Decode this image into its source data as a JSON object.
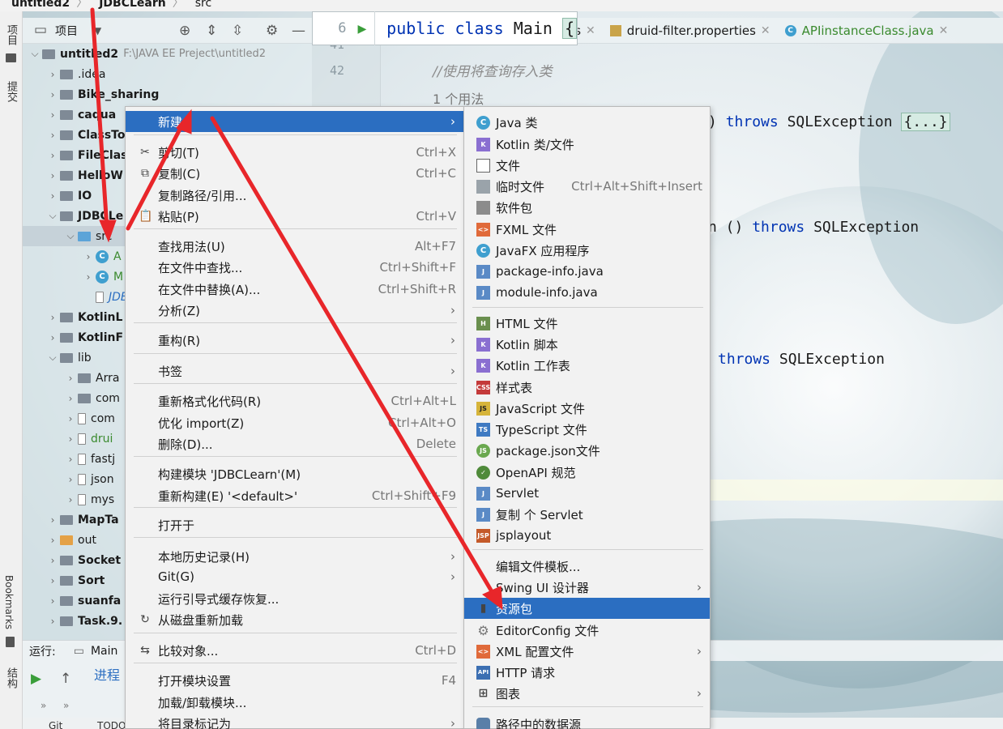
{
  "breadcrumb": {
    "project": "untitled2",
    "module": "JDBCLearn",
    "folder": "src"
  },
  "left_strip": {
    "project_tab": "项目",
    "commit_tab": "提交",
    "bookmarks_tab": "Bookmarks",
    "structure_tab": "结构"
  },
  "project_panel": {
    "title": "项目"
  },
  "tree": [
    {
      "label": "untitled2",
      "path": "F:\\JAVA EE Preject\\untitled2"
    },
    {
      "label": ".idea"
    },
    {
      "label": "Bike_sharing"
    },
    {
      "label": "caqua"
    },
    {
      "label": "ClassTo"
    },
    {
      "label": "FileClas"
    },
    {
      "label": "HelloW"
    },
    {
      "label": "IO"
    },
    {
      "label": "JDBCLe"
    },
    {
      "label": "src"
    },
    {
      "label": "A"
    },
    {
      "label": "M"
    },
    {
      "label": "JDBC"
    },
    {
      "label": "KotlinL"
    },
    {
      "label": "KotlinF"
    },
    {
      "label": "lib"
    },
    {
      "label": "Arra"
    },
    {
      "label": "com"
    },
    {
      "label": "com"
    },
    {
      "label": "drui"
    },
    {
      "label": "fastj"
    },
    {
      "label": "json"
    },
    {
      "label": "mys"
    },
    {
      "label": "MapTa"
    },
    {
      "label": "out"
    },
    {
      "label": "Socket"
    },
    {
      "label": "Sort"
    },
    {
      "label": "suanfa"
    },
    {
      "label": "Task.9."
    }
  ],
  "run_bar": {
    "label": "运行:",
    "tab": "Main",
    "process": "进程"
  },
  "bottom_bar": {
    "git": "Git",
    "todo": "TODO"
  },
  "editor": {
    "sticky": {
      "line": "6",
      "code_kw1": "public",
      "code_kw2": "class",
      "code_name": "Main",
      "brace": "{"
    },
    "line_numbers": [
      "41",
      "42"
    ],
    "comment": "//使用将查询存入类",
    "usage": "1 个用法",
    "code_lines": [
      {
        "pre": ")",
        "kw": "throws",
        "rest": "SQLException",
        "fold": "{...}"
      },
      {
        "pre": "n ()",
        "kw": "throws",
        "rest": "SQLException"
      },
      {
        "pre": "",
        "kw": "throws",
        "rest": "SQLException"
      }
    ]
  },
  "tabs": [
    {
      "label": "es"
    },
    {
      "label": "druid-filter.properties"
    },
    {
      "label": "APIinstanceClass.java"
    }
  ],
  "context_menu": [
    {
      "label": "新建",
      "submenu": true,
      "active": true
    },
    {
      "label": "剪切(T)",
      "shortcut": "Ctrl+X",
      "icon": "scissors-icon"
    },
    {
      "label": "复制(C)",
      "shortcut": "Ctrl+C",
      "icon": "copy-icon"
    },
    {
      "label": "复制路径/引用..."
    },
    {
      "label": "粘贴(P)",
      "shortcut": "Ctrl+V",
      "icon": "paste-icon"
    },
    {
      "label": "查找用法(U)",
      "shortcut": "Alt+F7"
    },
    {
      "label": "在文件中查找...",
      "shortcut": "Ctrl+Shift+F"
    },
    {
      "label": "在文件中替换(A)...",
      "shortcut": "Ctrl+Shift+R"
    },
    {
      "label": "分析(Z)",
      "submenu": true
    },
    {
      "label": "重构(R)",
      "submenu": true
    },
    {
      "label": "书签",
      "submenu": true
    },
    {
      "label": "重新格式化代码(R)",
      "shortcut": "Ctrl+Alt+L"
    },
    {
      "label": "优化 import(Z)",
      "shortcut": "Ctrl+Alt+O"
    },
    {
      "label": "删除(D)...",
      "shortcut": "Delete"
    },
    {
      "label": "构建模块 'JDBCLearn'(M)"
    },
    {
      "label": "重新构建(E) '<default>'",
      "shortcut": "Ctrl+Shift+F9"
    },
    {
      "label": "打开于",
      "submenu": true
    },
    {
      "label": "本地历史记录(H)",
      "submenu": true
    },
    {
      "label": "Git(G)",
      "submenu": true
    },
    {
      "label": "运行引导式缓存恢复..."
    },
    {
      "label": "从磁盘重新加载",
      "icon": "reload-icon"
    },
    {
      "label": "比较对象...",
      "shortcut": "Ctrl+D",
      "icon": "compare-icon"
    },
    {
      "label": "打开模块设置",
      "shortcut": "F4"
    },
    {
      "label": "加载/卸载模块..."
    },
    {
      "label": "将目录标记为",
      "submenu": true
    }
  ],
  "new_submenu": [
    {
      "label": "Java 类",
      "icon": "c",
      "glyph": "C"
    },
    {
      "label": "Kotlin 类/文件",
      "icon": "k",
      "glyph": "K"
    },
    {
      "label": "文件",
      "icon": "f",
      "glyph": ""
    },
    {
      "label": "临时文件",
      "shortcut": "Ctrl+Alt+Shift+Insert",
      "icon": "t",
      "glyph": ""
    },
    {
      "label": "软件包",
      "icon": "p",
      "glyph": ""
    },
    {
      "label": "FXML 文件",
      "icon": "x",
      "glyph": "<>"
    },
    {
      "label": "JavaFX 应用程序",
      "icon": "c",
      "glyph": "C"
    },
    {
      "label": "package-info.java",
      "icon": "j",
      "glyph": "J"
    },
    {
      "label": "module-info.java",
      "icon": "j",
      "glyph": "J"
    },
    {
      "label": "HTML 文件",
      "icon": "h",
      "glyph": "H"
    },
    {
      "label": "Kotlin 脚本",
      "icon": "k",
      "glyph": "K"
    },
    {
      "label": "Kotlin 工作表",
      "icon": "k",
      "glyph": "K"
    },
    {
      "label": "样式表",
      "icon": "css",
      "glyph": "CSS"
    },
    {
      "label": "JavaScript 文件",
      "icon": "js",
      "glyph": "JS"
    },
    {
      "label": "TypeScript 文件",
      "icon": "ts",
      "glyph": "TS"
    },
    {
      "label": "package.json文件",
      "icon": "pkg",
      "glyph": "JS"
    },
    {
      "label": "OpenAPI 规范",
      "icon": "oa",
      "glyph": "✓"
    },
    {
      "label": "Servlet",
      "icon": "j",
      "glyph": "J"
    },
    {
      "label": "复制 个 Servlet",
      "icon": "j",
      "glyph": "J"
    },
    {
      "label": "jsplayout",
      "icon": "jsp",
      "glyph": "JSP"
    },
    {
      "label": "编辑文件模板..."
    },
    {
      "label": "Swing UI 设计器",
      "submenu": true
    },
    {
      "label": "资源包",
      "icon": "chart",
      "glyph": "▮",
      "active": true
    },
    {
      "label": "EditorConfig 文件",
      "icon": "gear",
      "glyph": "⚙"
    },
    {
      "label": "XML 配置文件",
      "icon": "x",
      "glyph": "<>",
      "submenu": true
    },
    {
      "label": "HTTP 请求",
      "icon": "api",
      "glyph": "API"
    },
    {
      "label": "图表",
      "icon": "chart",
      "glyph": "⊞",
      "submenu": true
    },
    {
      "label": "路径中的数据源",
      "icon": "db",
      "glyph": ""
    }
  ],
  "colors": {
    "accent": "#2b6ec1",
    "arrow": "#e8262a",
    "keyword": "#0033b3"
  }
}
